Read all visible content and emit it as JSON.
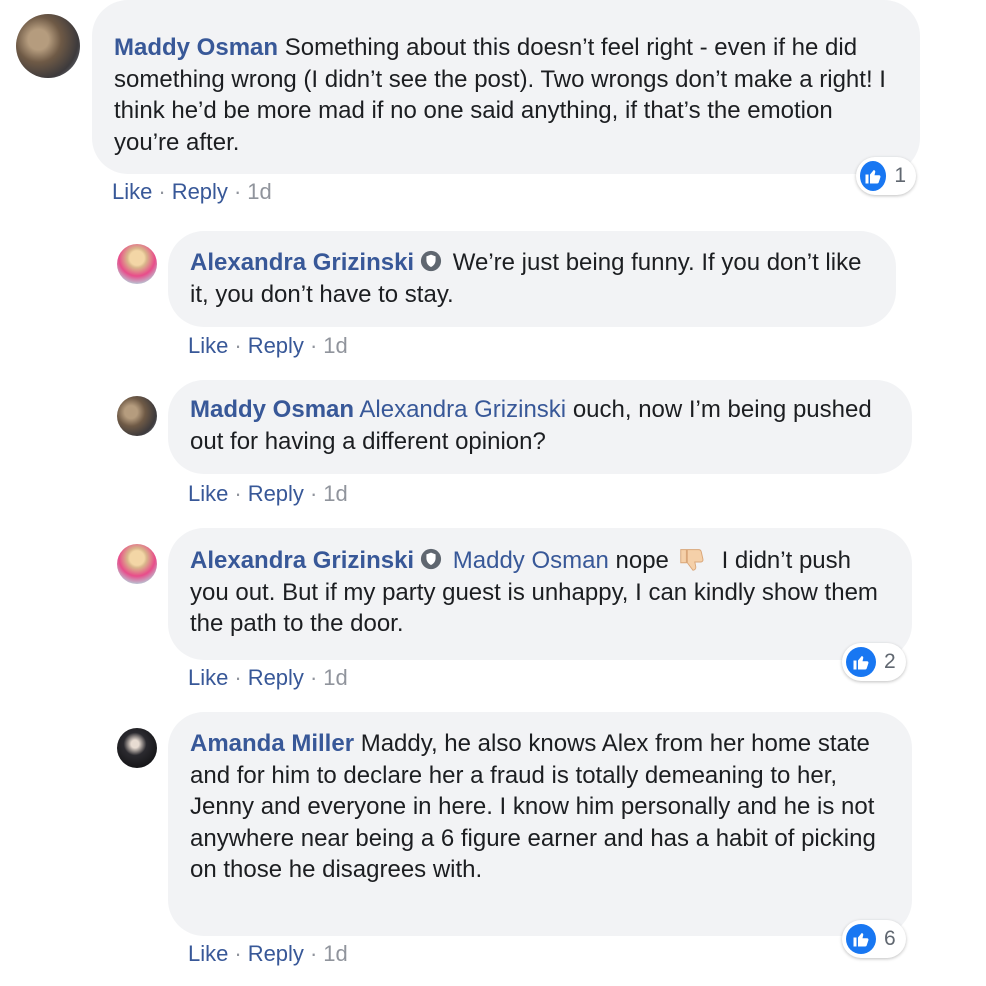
{
  "comments": [
    {
      "author": "Maddy Osman",
      "text": "Something about this doesn’t feel right - even if he did something wrong (I didn’t see the post). Two wrongs don’t make a right! I think he’d be more mad if no one said anything, if that’s the emotion you’re after.",
      "like": "Like",
      "reply": "Reply",
      "time": "1d",
      "reaction_count": "1",
      "replies": [
        {
          "author": "Alexandra Grizinski",
          "badge": "shield-icon",
          "text": "We’re just being funny. If you don’t like it, you don’t have to stay.",
          "like": "Like",
          "reply": "Reply",
          "time": "1d"
        },
        {
          "author": "Maddy Osman",
          "mention": "Alexandra Grizinski",
          "text": "ouch, now I’m being pushed out for having a different opinion?",
          "like": "Like",
          "reply": "Reply",
          "time": "1d"
        },
        {
          "author": "Alexandra Grizinski",
          "badge": "shield-icon",
          "mention": "Maddy Osman",
          "text_before_emoji": "nope",
          "emoji": "thumbs-down-emoji",
          "text": "I didn’t push you out. But if my party guest is unhappy, I can kindly show them the path to the door.",
          "like": "Like",
          "reply": "Reply",
          "time": "1d",
          "reaction_count": "2"
        },
        {
          "author": "Amanda Miller",
          "text": "Maddy, he also knows Alex from her home state and for him to declare her a fraud is totally demeaning to her, Jenny and everyone in here. I know him personally and he is not anywhere near being a 6 figure earner and has a habit of picking on those he disagrees with.",
          "like": "Like",
          "reply": "Reply",
          "time": "1d",
          "reaction_count": "6"
        }
      ]
    }
  ],
  "colors": {
    "name_link": "#385898",
    "bubble_bg": "#f2f3f5",
    "meta_gray": "#90949c",
    "like_blue": "#1877f2"
  }
}
